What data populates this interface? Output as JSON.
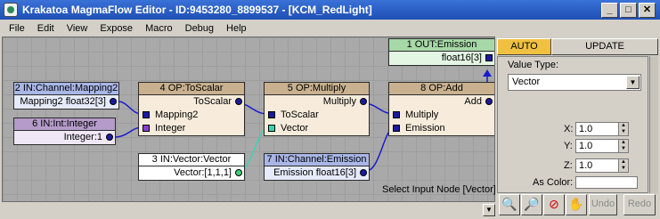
{
  "window": {
    "title": "Krakatoa MagmaFlow Editor - ID:9453280_8899537 - [KCM_RedLight]",
    "minimize": "_",
    "maximize": "□",
    "close": "✕"
  },
  "menu": [
    "File",
    "Edit",
    "View",
    "Expose",
    "Macro",
    "Debug",
    "Help"
  ],
  "nodes": {
    "out_emission": {
      "header": "1 OUT:Emission",
      "port": "float16[3]"
    },
    "in_mapping2": {
      "header": "2 IN:Channel:Mapping2",
      "port": "Mapping2 float32[3]"
    },
    "in_integer": {
      "header": "6 IN:Int:Integer",
      "port": "Integer:1"
    },
    "op_toscalar": {
      "header": "4 OP:ToScalar",
      "output": "ToScalar",
      "inputs": [
        "Mapping2",
        "Integer"
      ]
    },
    "op_multiply": {
      "header": "5 OP:Multiply",
      "output": "Multiply",
      "inputs": [
        "ToScalar",
        "Vector"
      ]
    },
    "op_add": {
      "header": "8 OP:Add",
      "output": "Add",
      "inputs": [
        "Multiply",
        "Emission"
      ]
    },
    "in_vector": {
      "header": "3 IN:Vector:Vector",
      "port": "Vector:[1,1,1]"
    },
    "in_emission": {
      "header": "7 IN:Channel:Emission",
      "port": "Emission float16[3]"
    }
  },
  "status_text": "Select Input Node [Vector]",
  "panel": {
    "tabs": [
      "AUTO",
      "UPDATE"
    ],
    "value_type_label": "Value Type:",
    "value_type": "Vector",
    "x_label": "X:",
    "x_value": "1.0",
    "y_label": "Y:",
    "y_value": "1.0",
    "z_label": "Z:",
    "z_value": "1.0",
    "color_label": "As Color:"
  },
  "toolbar": {
    "undo": "Undo",
    "redo": "Redo"
  },
  "icons": [
    "zoom-icon",
    "zoom-extents-icon",
    "zoom-off-icon",
    "pan-hand-icon"
  ],
  "colors": {
    "title_bar": "#1f4fb4",
    "canvas": "#a9a9a9",
    "node_body": "#f7ecdc",
    "op_header": "#c9b18f",
    "out_header": "#a7d8a7",
    "in_channel_header": "#a9b6e6",
    "in_int_header": "#b49bc9",
    "active_tab": "#f0c040",
    "port_blue": "#1a1aa0",
    "wire_blue": "#1a1ad0",
    "wire_teal": "#3fd1b4"
  }
}
